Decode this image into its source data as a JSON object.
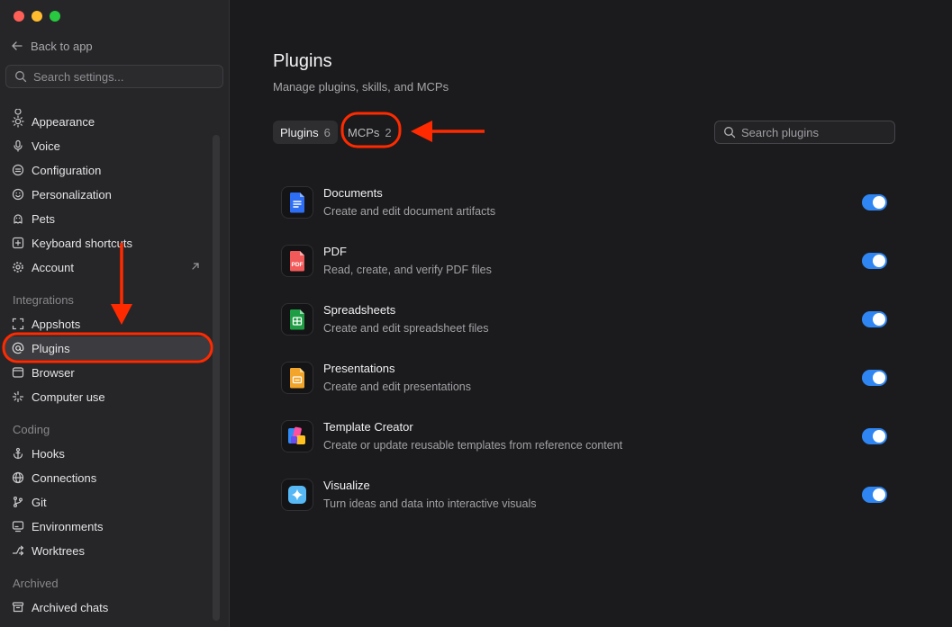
{
  "window": {
    "traffic_lights": [
      "#fe5f57",
      "#febc2e",
      "#28c840"
    ]
  },
  "sidebar": {
    "back_label": "Back to app",
    "search_placeholder": "Search settings...",
    "items": [
      {
        "label": "Appearance",
        "icon": "sun-icon"
      },
      {
        "label": "Voice",
        "icon": "microphone-icon"
      },
      {
        "label": "Configuration",
        "icon": "sliders-icon"
      },
      {
        "label": "Personalization",
        "icon": "smile-icon"
      },
      {
        "label": "Pets",
        "icon": "paw-icon"
      },
      {
        "label": "Keyboard shortcuts",
        "icon": "keyboard-icon"
      },
      {
        "label": "Account",
        "icon": "gear-icon"
      }
    ],
    "sections": {
      "integrations": {
        "title": "Integrations",
        "items": [
          {
            "label": "Appshots",
            "icon": "capture-icon"
          },
          {
            "label": "Plugins",
            "icon": "at-icon"
          },
          {
            "label": "Browser",
            "icon": "browser-icon"
          },
          {
            "label": "Computer use",
            "icon": "sparkle-icon"
          }
        ]
      },
      "coding": {
        "title": "Coding",
        "items": [
          {
            "label": "Hooks",
            "icon": "anchor-icon"
          },
          {
            "label": "Connections",
            "icon": "globe-icon"
          },
          {
            "label": "Git",
            "icon": "git-branch-icon"
          },
          {
            "label": "Environments",
            "icon": "monitor-icon"
          },
          {
            "label": "Worktrees",
            "icon": "worktree-icon"
          }
        ]
      },
      "archived": {
        "title": "Archived",
        "items": [
          {
            "label": "Archived chats",
            "icon": "archive-icon"
          }
        ]
      }
    },
    "active_item": "Plugins"
  },
  "main": {
    "title": "Plugins",
    "subtitle": "Manage plugins, skills, and MCPs",
    "tabs": [
      {
        "label": "Plugins",
        "count": "6",
        "active": true
      },
      {
        "label": "MCPs",
        "count": "2",
        "active": false
      }
    ],
    "search_placeholder": "Search plugins",
    "plugins": [
      {
        "name": "Documents",
        "description": "Create and edit document artifacts",
        "icon": "document-icon",
        "enabled": true
      },
      {
        "name": "PDF",
        "description": "Read, create, and verify PDF files",
        "icon": "pdf-icon",
        "enabled": true
      },
      {
        "name": "Spreadsheets",
        "description": "Create and edit spreadsheet files",
        "icon": "spreadsheet-icon",
        "enabled": true
      },
      {
        "name": "Presentations",
        "description": "Create and edit presentations",
        "icon": "presentation-icon",
        "enabled": true
      },
      {
        "name": "Template Creator",
        "description": "Create or update reusable templates from reference content",
        "icon": "template-icon",
        "enabled": true
      },
      {
        "name": "Visualize",
        "description": "Turn ideas and data into interactive visuals",
        "icon": "sparkle-icon",
        "enabled": true
      }
    ],
    "pdf_badge": "PDF"
  },
  "colors": {
    "accent": "#2f86f2",
    "annotation": "#ff2a00"
  }
}
